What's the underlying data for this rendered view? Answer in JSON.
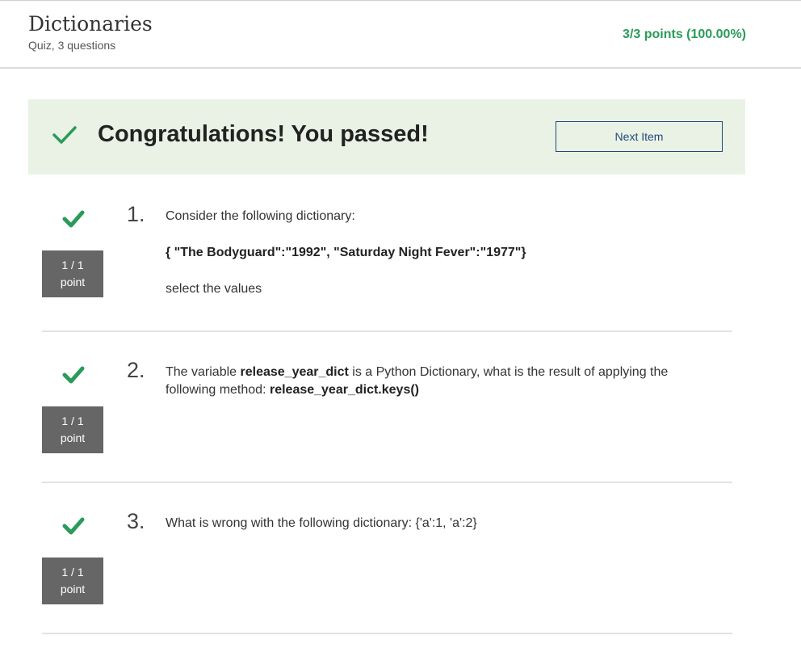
{
  "header": {
    "title": "Dictionaries",
    "subtitle": "Quiz, 3 questions",
    "score": "3/3 points (100.00%)"
  },
  "banner": {
    "message": "Congratulations! You passed!",
    "next_button": "Next Item"
  },
  "colors": {
    "accent_green": "#2a9b58",
    "banner_bg": "#e9f2e5",
    "button_blue": "#1f4a7a",
    "points_bg": "#666666"
  },
  "questions": [
    {
      "number": "1.",
      "points_line1": "1 / 1",
      "points_line2": "point",
      "text": "Consider the following dictionary:",
      "code": "{ \"The Bodyguard\":\"1992\", \"Saturday Night Fever\":\"1977\"}",
      "instruction": "select the values"
    },
    {
      "number": "2.",
      "points_line1": "1 / 1",
      "points_line2": "point",
      "text_part1": "The variable ",
      "text_bold1": "release_year_dict",
      "text_part2": " is a Python Dictionary, what is the result of applying the following method: ",
      "text_bold2": "release_year_dict.keys()"
    },
    {
      "number": "3.",
      "points_line1": "1 / 1",
      "points_line2": "point",
      "text": "What is wrong with the following dictionary: {'a':1, 'a':2}"
    }
  ]
}
